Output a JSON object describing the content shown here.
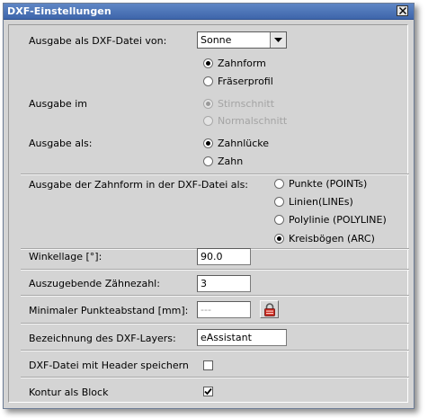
{
  "window": {
    "title": "DXF-Einstellungen"
  },
  "export_source": {
    "label": "Ausgabe als DXF-Datei von:",
    "selected": "Sonne",
    "options": [
      {
        "label": "Zahnform",
        "checked": true,
        "enabled": true
      },
      {
        "label": "Fräserprofil",
        "checked": false,
        "enabled": true
      }
    ]
  },
  "output_in": {
    "label": "Ausgabe im",
    "options": [
      {
        "label": "Stirnschnitt",
        "checked": true,
        "enabled": false
      },
      {
        "label": "Normalschnitt",
        "checked": false,
        "enabled": false
      }
    ]
  },
  "output_as": {
    "label": "Ausgabe als:",
    "options": [
      {
        "label": "Zahnlücke",
        "checked": true,
        "enabled": true
      },
      {
        "label": "Zahn",
        "checked": false,
        "enabled": true
      }
    ]
  },
  "tooth_form_output": {
    "label": "Ausgabe der Zahnform in der DXF-Datei als:",
    "options": [
      {
        "label": "Punkte (POINTs)",
        "checked": false
      },
      {
        "label": "Linien(LINEs)",
        "checked": false
      },
      {
        "label": "Polylinie (POLYLINE)",
        "checked": false
      },
      {
        "label": "Kreisbögen (ARC)",
        "checked": true
      }
    ]
  },
  "angle_position": {
    "label": "Winkellage [°]:",
    "value": "90.0"
  },
  "tooth_count": {
    "label": "Auszugebende Zähnezahl:",
    "value": "3"
  },
  "min_point_distance": {
    "label": "Minimaler Punkteabstand [mm]:",
    "value": "---"
  },
  "layer_name": {
    "label": "Bezeichnung des DXF-Layers:",
    "value": "eAssistant"
  },
  "save_with_header": {
    "label": "DXF-Datei mit Header speichern",
    "checked": false
  },
  "contour_as_block": {
    "label": "Kontur als Block",
    "checked": true
  },
  "colors": {
    "title_bar": "#4a72b8",
    "dialog_background": "#d4d4d4",
    "disabled_text": "#a4a4a4"
  },
  "icons": [
    "close-icon",
    "dropdown-arrow-icon",
    "lock-icon",
    "checkmark-icon"
  ]
}
